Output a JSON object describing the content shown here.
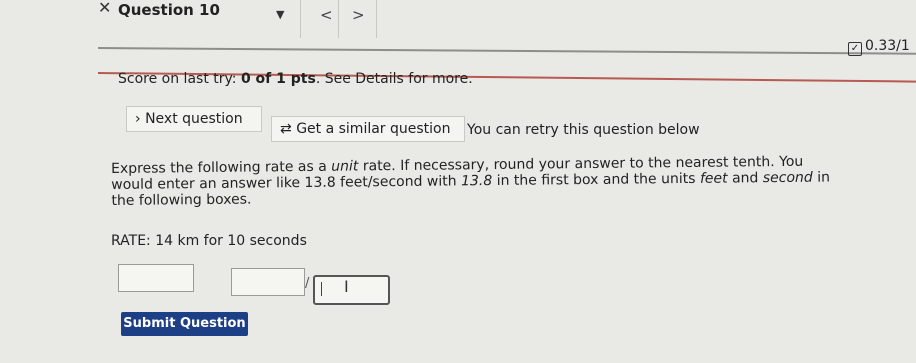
{
  "header": {
    "close_symbol": "✕",
    "question_title": "Question 10",
    "dropdown_caret": "▼",
    "prev_symbol": "<",
    "next_symbol": ">",
    "score": "0.33/1",
    "score_icon": "check-box-icon"
  },
  "status": {
    "prefix": "Score on last try: ",
    "score": "0 of 1 pts",
    "suffix": ". See Details for more."
  },
  "actions": {
    "next_question": "Next question",
    "next_icon": "›",
    "similar_question": "Get a similar question",
    "similar_icon": "⇄",
    "retry_note": "You can retry this question below"
  },
  "prompt": {
    "part1": "Express the following rate as a ",
    "unit_word": "unit",
    "part2": " rate. If necessary, round your answer to the nearest tenth. You would enter an answer like 13.8 feet/second with ",
    "example_value": "13.8",
    "part3": " in the first box and the units ",
    "feet": "feet",
    "and": " and ",
    "second": "second",
    "part4": " in the following boxes.",
    "rate": "RATE: 14 km for 10 seconds"
  },
  "answer": {
    "value": "",
    "unit_numerator": "",
    "slash": "/",
    "unit_denominator": ""
  },
  "submit_label": "Submit Question"
}
